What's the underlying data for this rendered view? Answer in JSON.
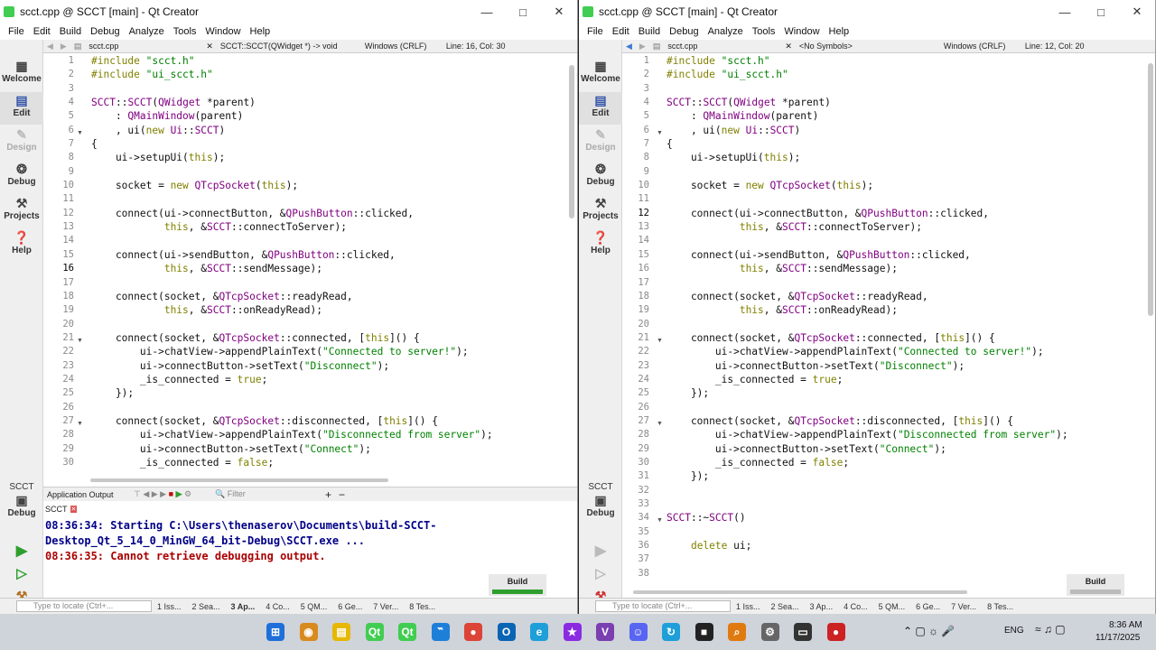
{
  "left": {
    "title": "scct.cpp @ SCCT [main] - Qt Creator",
    "menu": [
      "File",
      "Edit",
      "Build",
      "Debug",
      "Analyze",
      "Tools",
      "Window",
      "Help"
    ],
    "modes": [
      "Welcome",
      "Edit",
      "Design",
      "Debug",
      "Projects",
      "Help"
    ],
    "doc": {
      "file": "scct.cpp",
      "symbol": "SCCT::SCCT(QWidget *) -> void",
      "encoding": "Windows (CRLF)",
      "position": "Line: 16, Col: 30"
    },
    "lines": [
      "#include \"scct.h\"",
      "#include \"ui_scct.h\"",
      "",
      "SCCT::SCCT(QWidget *parent)",
      "    : QMainWindow(parent)",
      "    , ui(new Ui::SCCT)",
      "{",
      "    ui->setupUi(this);",
      "",
      "    socket = new QTcpSocket(this);",
      "",
      "    connect(ui->connectButton, &QPushButton::clicked,",
      "            this, &SCCT::connectToServer);",
      "",
      "    connect(ui->sendButton, &QPushButton::clicked,",
      "            this, &SCCT::sendMessage);",
      "",
      "    connect(socket, &QTcpSocket::readyRead,",
      "            this, &SCCT::onReadyRead);",
      "",
      "    connect(socket, &QTcpSocket::connected, [this]() {",
      "        ui->chatView->appendPlainText(\"Connected to server!\");",
      "        ui->connectButton->setText(\"Disconnect\");",
      "        _is_connected = true;",
      "    });",
      "",
      "    connect(socket, &QTcpSocket::disconnected, [this]() {",
      "        ui->chatView->appendPlainText(\"Disconnected from server\");",
      "        ui->connectButton->setText(\"Connect\");",
      "        _is_connected = false;"
    ],
    "line_numbers": [
      "1",
      "2",
      "3",
      "4",
      "5",
      "6",
      "7",
      "8",
      "9",
      "10",
      "11",
      "12",
      "13",
      "14",
      "15",
      "16",
      "17",
      "18",
      "19",
      "20",
      "21",
      "22",
      "23",
      "24",
      "25",
      "26",
      "27",
      "28",
      "29",
      "30"
    ],
    "output": {
      "pane_title": "Application Output",
      "filter_placeholder": "Filter",
      "tab": "SCCT",
      "lines": [
        "08:36:34: Starting C:\\Users\\thenaserov\\Documents\\build-SCCT-",
        "Desktop_Qt_5_14_0_MinGW_64_bit-Debug\\SCCT.exe ...",
        "08:36:35: Cannot retrieve debugging output."
      ]
    },
    "kit": {
      "project": "SCCT",
      "mode": "Debug"
    },
    "build_label": "Build",
    "locate_placeholder": "Type to locate (Ctrl+...",
    "panes": [
      "1 Iss...",
      "2 Sea...",
      "3 Ap...",
      "4 Co...",
      "5 QM...",
      "6 Ge...",
      "7 Ver...",
      "8 Tes..."
    ]
  },
  "right": {
    "title": "scct.cpp @ SCCT [main] - Qt Creator",
    "menu": [
      "File",
      "Edit",
      "Build",
      "Debug",
      "Analyze",
      "Tools",
      "Window",
      "Help"
    ],
    "modes": [
      "Welcome",
      "Edit",
      "Design",
      "Debug",
      "Projects",
      "Help"
    ],
    "doc": {
      "file": "scct.cpp",
      "symbol": "<No Symbols>",
      "encoding": "Windows (CRLF)",
      "position": "Line: 12, Col: 20"
    },
    "lines": [
      "#include \"scct.h\"",
      "#include \"ui_scct.h\"",
      "",
      "SCCT::SCCT(QWidget *parent)",
      "    : QMainWindow(parent)",
      "    , ui(new Ui::SCCT)",
      "{",
      "    ui->setupUi(this);",
      "",
      "    socket = new QTcpSocket(this);",
      "",
      "    connect(ui->connectButton, &QPushButton::clicked,",
      "            this, &SCCT::connectToServer);",
      "",
      "    connect(ui->sendButton, &QPushButton::clicked,",
      "            this, &SCCT::sendMessage);",
      "",
      "    connect(socket, &QTcpSocket::readyRead,",
      "            this, &SCCT::onReadyRead);",
      "",
      "    connect(socket, &QTcpSocket::connected, [this]() {",
      "        ui->chatView->appendPlainText(\"Connected to server!\");",
      "        ui->connectButton->setText(\"Disconnect\");",
      "        _is_connected = true;",
      "    });",
      "",
      "    connect(socket, &QTcpSocket::disconnected, [this]() {",
      "        ui->chatView->appendPlainText(\"Disconnected from server\");",
      "        ui->connectButton->setText(\"Connect\");",
      "        _is_connected = false;",
      "    });",
      "",
      "",
      "SCCT::~SCCT()",
      "",
      "    delete ui;",
      "",
      ""
    ],
    "line_numbers": [
      "1",
      "2",
      "3",
      "4",
      "5",
      "6",
      "7",
      "8",
      "9",
      "10",
      "11",
      "12",
      "13",
      "14",
      "15",
      "16",
      "17",
      "18",
      "19",
      "20",
      "21",
      "22",
      "23",
      "24",
      "25",
      "26",
      "27",
      "28",
      "29",
      "30",
      "31",
      "32",
      "33",
      "34",
      "35",
      "36",
      "37",
      "38"
    ],
    "kit": {
      "project": "SCCT",
      "mode": "Debug"
    },
    "build_label": "Build",
    "locate_placeholder": "Type to locate (Ctrl+...",
    "panes": [
      "1 Iss...",
      "2 Sea...",
      "3 Ap...",
      "4 Co...",
      "5 QM...",
      "6 Ge...",
      "7 Ver...",
      "8 Tes..."
    ]
  },
  "syntax_colors": {
    "keyword": "#808000",
    "type": "#800080",
    "string": "#008000",
    "func": "#00677c",
    "text": "#111111",
    "error": "#aa0000",
    "accent": "#2e9e2e"
  },
  "taskbar": {
    "time": "8:36 AM",
    "date": "11/17/2025",
    "lang": "ENG",
    "icons": [
      "start-icon",
      "copilot-icon",
      "explorer-icon",
      "qt-creator-icon",
      "qt-icon",
      "vscode-icon",
      "chrome-icon",
      "outlook-icon",
      "edge-icon",
      "app-icon",
      "visual-studio-icon",
      "discord-icon",
      "app2-icon",
      "terminal-icon",
      "search-app-icon",
      "settings-icon",
      "console-icon",
      "recorder-icon"
    ]
  }
}
